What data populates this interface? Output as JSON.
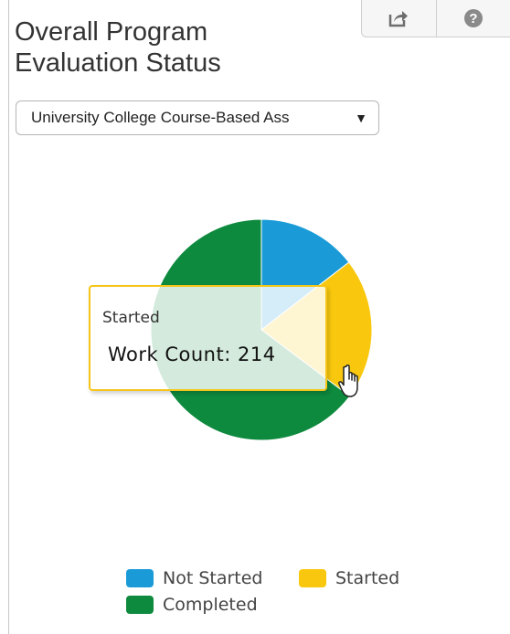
{
  "panel": {
    "title": "Overall Program Evaluation Status",
    "toolbar": {
      "share_icon": "share-icon",
      "help_icon": "help-icon"
    },
    "dropdown": {
      "selected": "University College Course-Based Ass"
    }
  },
  "chart_data": {
    "type": "pie",
    "title": "Overall Program Evaluation Status",
    "slices": [
      {
        "label": "Not Started",
        "value": 150,
        "color": "#1a9bd7"
      },
      {
        "label": "Started",
        "value": 214,
        "color": "#f9c80e"
      },
      {
        "label": "Completed",
        "value": 668,
        "color": "#0e8a3e"
      }
    ],
    "legend": [
      "Not Started",
      "Started",
      "Completed"
    ],
    "legend_position": "bottom"
  },
  "tooltip": {
    "label": "Started",
    "value_text": "Work Count: 214"
  }
}
